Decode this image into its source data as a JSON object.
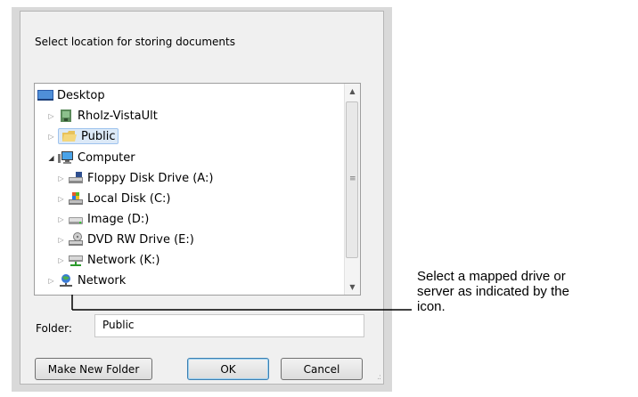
{
  "dialog": {
    "instruction": "Select location for storing documents",
    "folder_label": "Folder:",
    "folder_value": "Public",
    "buttons": {
      "make_new_folder": "Make New Folder",
      "ok": "OK",
      "cancel": "Cancel"
    }
  },
  "tree": {
    "items": [
      {
        "label": "Desktop",
        "icon": "desktop-icon"
      },
      {
        "label": "Rholz-VistaUlt",
        "icon": "user-folder-icon"
      },
      {
        "label": "Public",
        "icon": "folder-icon",
        "selected": true
      },
      {
        "label": "Computer",
        "icon": "computer-icon",
        "expanded": true
      },
      {
        "label": "Floppy Disk Drive (A:)",
        "icon": "floppy-drive-icon"
      },
      {
        "label": "Local Disk (C:)",
        "icon": "local-disk-icon"
      },
      {
        "label": "Image (D:)",
        "icon": "drive-icon"
      },
      {
        "label": "DVD RW Drive (E:)",
        "icon": "dvd-drive-icon"
      },
      {
        "label": "Network (K:)",
        "icon": "network-drive-icon"
      },
      {
        "label": "Network",
        "icon": "network-icon"
      }
    ]
  },
  "callout": {
    "text": "Select a mapped drive or\nserver as indicated by the\nicon."
  },
  "colors": {
    "selection": "#dce9f7",
    "selection_border": "#9ec3ee",
    "dialog_bg": "#f0f0f0"
  }
}
